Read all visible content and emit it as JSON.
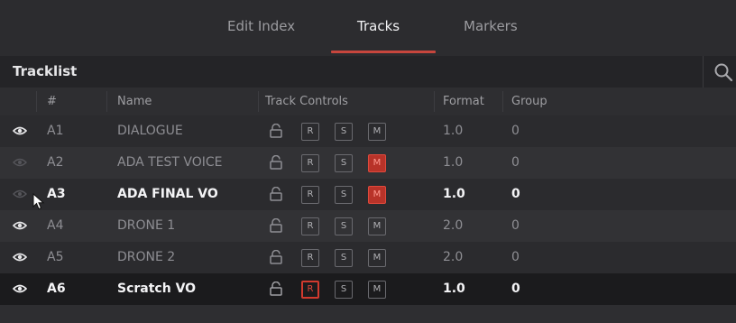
{
  "tabs": [
    {
      "label": "Edit Index",
      "active": false
    },
    {
      "label": "Tracks",
      "active": true
    },
    {
      "label": "Markers",
      "active": false
    }
  ],
  "tracklist": {
    "title": "Tracklist"
  },
  "columns": {
    "num": "#",
    "name": "Name",
    "controls": "Track Controls",
    "format": "Format",
    "group": "Group"
  },
  "buttons": {
    "record": "R",
    "solo": "S",
    "mute": "M"
  },
  "tracks": [
    {
      "id": "A1",
      "name": "DIALOGUE",
      "format": "1.0",
      "group": "0",
      "visible": true,
      "record": "off",
      "mute": "off"
    },
    {
      "id": "A2",
      "name": "ADA TEST VOICE",
      "format": "1.0",
      "group": "0",
      "visible": false,
      "record": "off",
      "mute": "on"
    },
    {
      "id": "A3",
      "name": "ADA FINAL VO",
      "format": "1.0",
      "group": "0",
      "visible": false,
      "record": "off",
      "mute": "on"
    },
    {
      "id": "A4",
      "name": "DRONE 1",
      "format": "2.0",
      "group": "0",
      "visible": true,
      "record": "off",
      "mute": "off"
    },
    {
      "id": "A5",
      "name": "DRONE 2",
      "format": "2.0",
      "group": "0",
      "visible": true,
      "record": "off",
      "mute": "off"
    },
    {
      "id": "A6",
      "name": "Scratch VO",
      "format": "1.0",
      "group": "0",
      "visible": true,
      "record": "armed",
      "mute": "off"
    }
  ],
  "colors": {
    "accent": "#c7463d",
    "mute_on": "#b83329",
    "record_armed": "#d23a2e"
  }
}
